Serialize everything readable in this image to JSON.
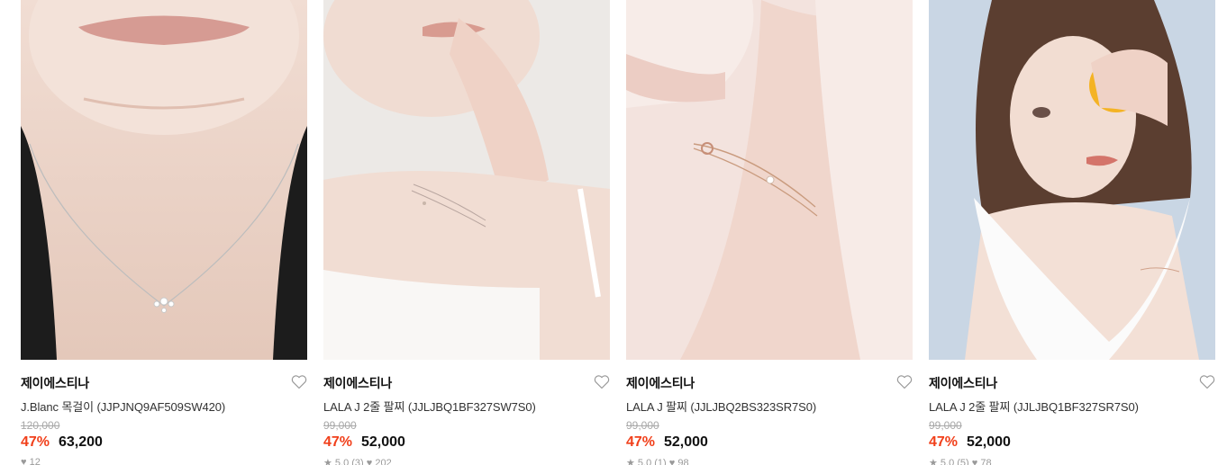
{
  "products": [
    {
      "brand": "제이에스티나",
      "name": "J.Blanc 목걸이 (JJPJNQ9AF509SW420)",
      "original_price": "120,000",
      "discount": "47%",
      "price": "63,200",
      "meta": "♥ 12",
      "image": "necklace-model-photo",
      "bg_color": "#e9d9d0"
    },
    {
      "brand": "제이에스티나",
      "name": "LALA J 2줄 팔찌 (JJLJBQ1BF327SW7S0)",
      "original_price": "99,000",
      "discount": "47%",
      "price": "52,000",
      "meta": "★ 5.0 (3)   ♥ 202",
      "image": "bracelet-model-photo",
      "bg_color": "#ece9e6"
    },
    {
      "brand": "제이에스티나",
      "name": "LALA J 팔찌 (JJLJBQ2BS323SR7S0)",
      "original_price": "99,000",
      "discount": "47%",
      "price": "52,000",
      "meta": "★ 5.0 (1)   ♥ 98",
      "image": "bracelet-arm-photo",
      "bg_color": "#f3e3de"
    },
    {
      "brand": "제이에스티나",
      "name": "LALA J 2줄 팔찌 (JJLJBQ1BF327SR7S0)",
      "original_price": "99,000",
      "discount": "47%",
      "price": "52,000",
      "meta": "★ 5.0 (5)   ♥ 78",
      "image": "model-with-lemon-photo",
      "bg_color": "#c9d6e4"
    }
  ],
  "icons": {
    "wishlist": "heart-outline-icon"
  },
  "colors": {
    "discount": "#f13f1a",
    "price": "#111111",
    "original_price": "#a8a8a8"
  }
}
